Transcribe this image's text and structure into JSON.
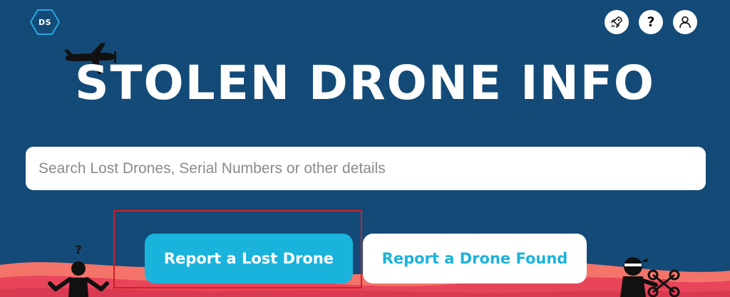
{
  "header": {
    "logo_text": "DS",
    "icons": [
      {
        "name": "rocket-icon"
      },
      {
        "name": "help-icon",
        "glyph": "?"
      },
      {
        "name": "user-icon"
      }
    ]
  },
  "hero": {
    "title": "STOLEN DRONE INFO"
  },
  "search": {
    "placeholder": "Search Lost Drones, Serial Numbers or other details",
    "value": ""
  },
  "actions": {
    "report_lost_label": "Report a Lost Drone",
    "report_found_label": "Report a Drone Found"
  },
  "illustrations": {
    "confused_mark": "?"
  },
  "colors": {
    "background": "#134a77",
    "accent": "#19b3dc",
    "wave_light": "#f4746a",
    "wave_dark": "#e8455a",
    "highlight": "#d0202a"
  }
}
